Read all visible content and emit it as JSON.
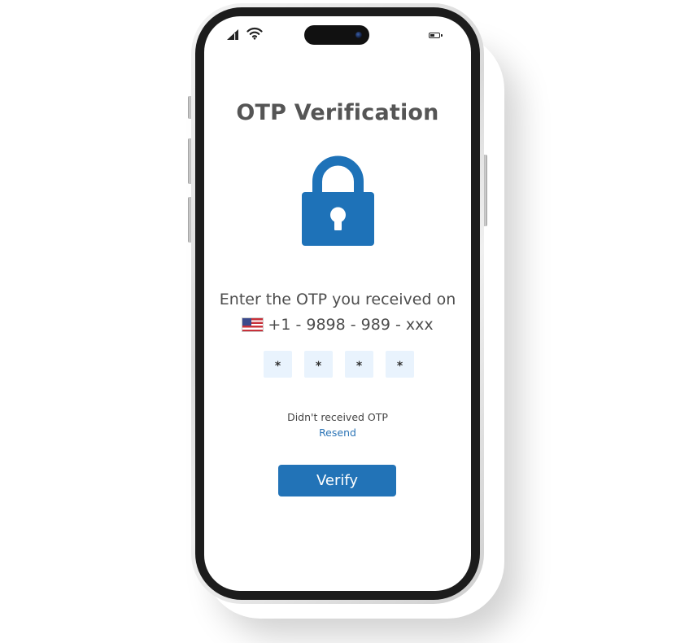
{
  "status_bar": {
    "signal_icon": "cellular-signal-icon",
    "wifi_icon": "wifi-icon",
    "battery_icon": "battery-icon",
    "battery_level": 0.45
  },
  "screen": {
    "title": "OTP Verification",
    "lock_icon": "padlock-icon",
    "instruction": "Enter the OTP you received on",
    "flag_icon": "us-flag-icon",
    "phone_number": "+1 - 9898 - 989 - xxx",
    "otp_digits": [
      "*",
      "*",
      "*",
      "*"
    ],
    "didnt_receive": "Didn't received OTP",
    "resend_label": "Resend",
    "verify_label": "Verify"
  },
  "colors": {
    "accent": "#2273b7",
    "title_text": "#555555",
    "otp_box_bg": "#e9f3fd",
    "link": "#2b74b6"
  }
}
